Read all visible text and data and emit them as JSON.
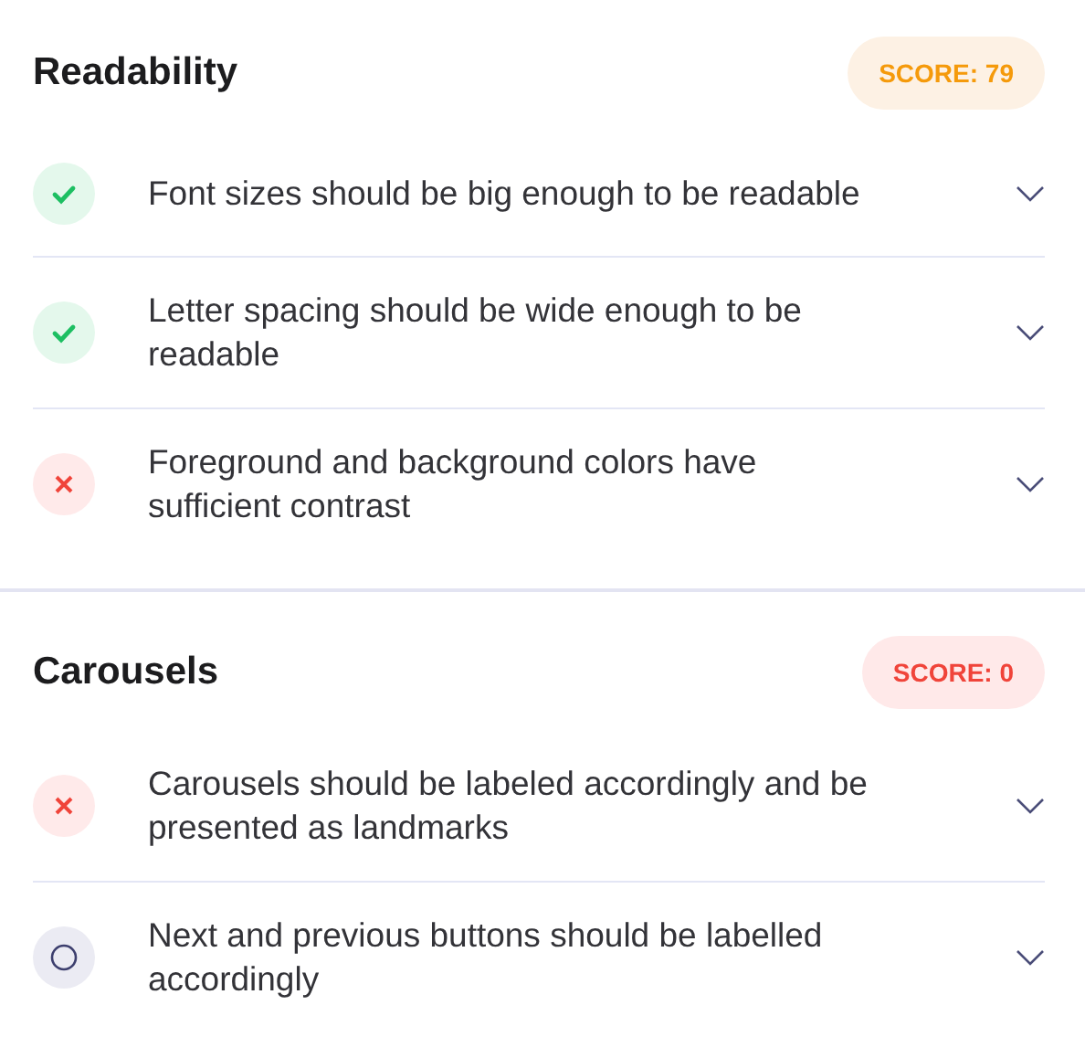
{
  "sections": [
    {
      "title": "Readability",
      "score": "SCORE: 79",
      "kind": "warning",
      "items": [
        {
          "text": "Font sizes should be big enough to be readable",
          "kind": "pass"
        },
        {
          "text": "Letter spacing should be wide enough to be readable",
          "kind": "pass"
        },
        {
          "text": "Foreground and background colors have sufficient contrast",
          "kind": "fail"
        }
      ]
    },
    {
      "title": "Carousels",
      "score": "SCORE: 0",
      "kind": "fail",
      "items": [
        {
          "text": "Carousels should be labeled accordingly and be presented as landmarks",
          "kind": "fail"
        },
        {
          "text": "Next and previous buttons should be labelled accordingly",
          "kind": "pending"
        }
      ]
    }
  ]
}
